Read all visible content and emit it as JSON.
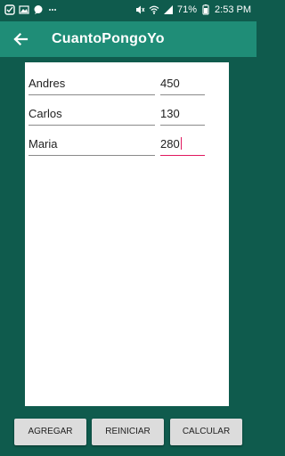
{
  "status_bar": {
    "battery": "71%",
    "time": "2:53 PM",
    "icons_left": [
      "notification-icon",
      "image-icon",
      "chat-icon",
      "more-dots-icon"
    ],
    "icons_right": [
      "mute-icon",
      "wifi-icon",
      "signal-icon",
      "battery-icon"
    ]
  },
  "app_bar": {
    "title": "CuantoPongoYo"
  },
  "entries": [
    {
      "name": "Andres",
      "amount": "450"
    },
    {
      "name": "Carlos",
      "amount": "130"
    },
    {
      "name": "Maria",
      "amount": "280"
    }
  ],
  "buttons": {
    "add": "AGREGAR",
    "reset": "REINICIAR",
    "calculate": "CALCULAR"
  },
  "colors": {
    "status_bar": "#0f5b4d",
    "app_bar": "#1f8d77",
    "accent": "#e0195f",
    "panel": "#ffffff",
    "button": "#dcdcdc"
  }
}
